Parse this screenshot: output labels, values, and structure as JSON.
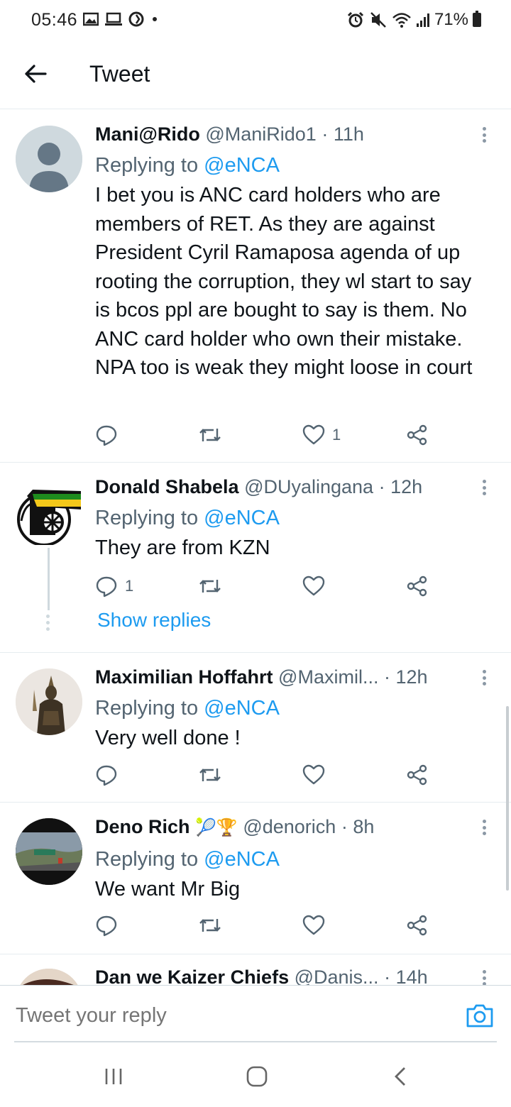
{
  "status_bar": {
    "time": "05:46",
    "battery": "71%"
  },
  "header": {
    "title": "Tweet"
  },
  "tweets": [
    {
      "name": "Mani@Rido",
      "handle": "@ManiRido1",
      "time": "11h",
      "replying_label": "Replying to",
      "replying_to": "@eNCA",
      "text": "I bet you is ANC card holders who are members of RET. As they are against President Cyril Ramaposa agenda of up rooting the corruption, they wl start to say is bcos ppl are bought to say is them. No ANC card holder who own their mistake. NPA too is weak they might loose in court",
      "reply_count": "",
      "retweet_count": "",
      "like_count": "1"
    },
    {
      "name": "Donald Shabela",
      "handle": "@DUyalingana",
      "time": "12h",
      "replying_label": "Replying to",
      "replying_to": "@eNCA",
      "text": "They are from KZN",
      "reply_count": "1",
      "retweet_count": "",
      "like_count": "",
      "show_replies": "Show replies"
    },
    {
      "name": "Maximilian Hoffahrt",
      "handle": "@Maximil...",
      "time": "12h",
      "replying_label": "Replying to",
      "replying_to": "@eNCA",
      "text": "Very well done !",
      "reply_count": "",
      "retweet_count": "",
      "like_count": ""
    },
    {
      "name": "Deno Rich",
      "name_emoji": "🎾🏆",
      "handle": "@denorich",
      "time": "8h",
      "replying_label": "Replying to",
      "replying_to": "@eNCA",
      "text": "We want Mr Big",
      "reply_count": "",
      "retweet_count": "",
      "like_count": ""
    },
    {
      "name": "Dan we Kaizer Chiefs",
      "handle": "@Danis...",
      "time": "14h"
    }
  ],
  "reply_bar": {
    "placeholder": "Tweet your reply"
  },
  "colors": {
    "accent": "#1d9bf0",
    "text": "#0f1419",
    "muted": "#536471",
    "divider": "#e6ecf0"
  }
}
